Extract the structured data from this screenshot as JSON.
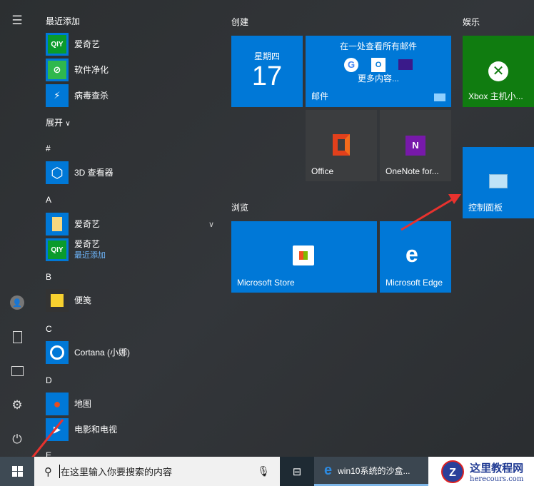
{
  "sidebar": {
    "items": [
      "menu",
      "user",
      "documents",
      "pictures",
      "settings",
      "power"
    ]
  },
  "app_list": {
    "recent_header": "最近添加",
    "recent": [
      {
        "name": "爱奇艺",
        "icon": "QIY"
      },
      {
        "name": "软件净化",
        "icon": "clean"
      },
      {
        "name": "病毒查杀",
        "icon": "shield"
      }
    ],
    "expand": "展开",
    "sections": [
      {
        "letter": "#",
        "apps": [
          {
            "name": "3D 查看器"
          }
        ]
      },
      {
        "letter": "A",
        "apps": [
          {
            "name": "爱奇艺"
          },
          {
            "name": "爱奇艺",
            "sub": "最近添加"
          }
        ]
      },
      {
        "letter": "B",
        "apps": [
          {
            "name": "便笺"
          }
        ]
      },
      {
        "letter": "C",
        "apps": [
          {
            "name": "Cortana (小娜)"
          }
        ]
      },
      {
        "letter": "D",
        "apps": [
          {
            "name": "地图"
          },
          {
            "name": "电影和电视"
          }
        ]
      },
      {
        "letter": "E",
        "apps": []
      }
    ]
  },
  "tiles": {
    "group_create": "创建",
    "group_browse": "浏览",
    "group_entertain": "娱乐",
    "calendar": {
      "weekday": "星期四",
      "day": "17"
    },
    "mail": {
      "headline": "在一处查看所有邮件",
      "more": "更多内容...",
      "label": "邮件"
    },
    "office": "Office",
    "onenote": "OneNote for...",
    "store": "Microsoft Store",
    "edge": "Microsoft Edge",
    "xbox": "Xbox 主机小...",
    "control_panel": "控制面板"
  },
  "taskbar": {
    "search_placeholder": "在这里输入你要搜索的内容",
    "window_title": "win10系统的沙盒...",
    "watermark_title": "这里教程网",
    "watermark_url": "herecours.com"
  },
  "colors": {
    "accent": "#0078d7",
    "xbox": "#107c10",
    "arrow": "#e8322e"
  }
}
